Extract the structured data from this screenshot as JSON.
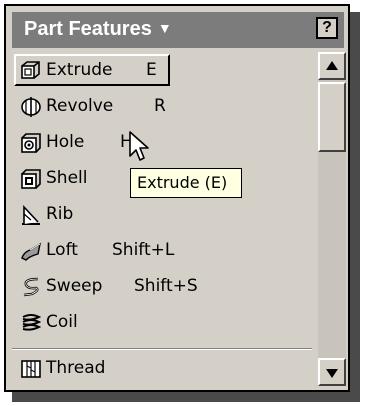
{
  "panel": {
    "title": "Part Features",
    "title_caret": "▼",
    "help_label": "?"
  },
  "items": [
    {
      "label": "Extrude",
      "shortcut": "E",
      "icon": "extrude-icon"
    },
    {
      "label": "Revolve",
      "shortcut": "R",
      "icon": "revolve-icon"
    },
    {
      "label": "Hole",
      "shortcut": "H",
      "icon": "hole-icon"
    },
    {
      "label": "Shell",
      "shortcut": "",
      "icon": "shell-icon"
    },
    {
      "label": "Rib",
      "shortcut": "",
      "icon": "rib-icon"
    },
    {
      "label": "Loft",
      "shortcut": "Shift+L",
      "icon": "loft-icon"
    },
    {
      "label": "Sweep",
      "shortcut": "Shift+S",
      "icon": "sweep-icon"
    },
    {
      "label": "Coil",
      "shortcut": "",
      "icon": "coil-icon"
    },
    {
      "label": "Thread",
      "shortcut": "",
      "icon": "thread-icon"
    }
  ],
  "tooltip": "Extrude (E)",
  "scrollbar": {
    "up": "▲",
    "down": "▼"
  }
}
